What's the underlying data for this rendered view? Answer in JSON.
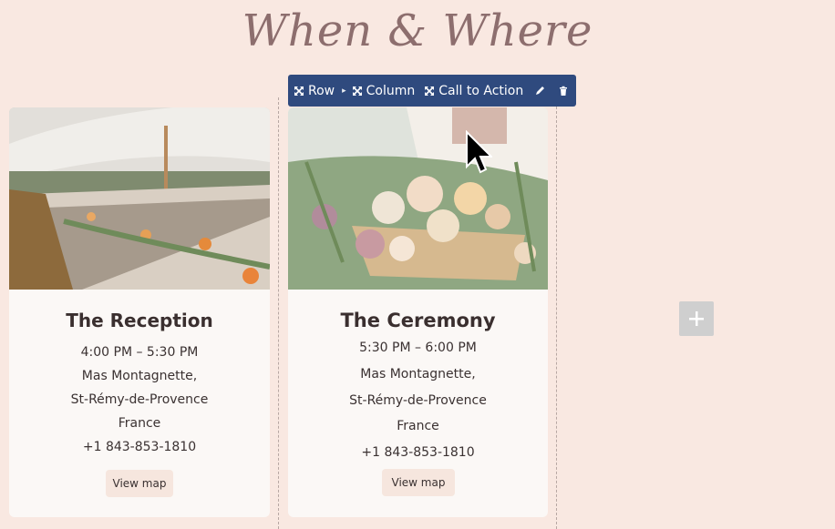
{
  "page": {
    "title": "When & Where"
  },
  "toolbar": {
    "row_label": "Row",
    "column_label": "Column",
    "cta_label": "Call to Action"
  },
  "cards": [
    {
      "title": "The Reception",
      "time": "4:00 PM – 5:30 PM",
      "venue": "Mas Montagnette,",
      "city": "St-Rémy-de-Provence",
      "country": "France",
      "phone": "+1 843-853-1810",
      "map_label": "View map"
    },
    {
      "title": "The Ceremony",
      "time": "5:30 PM – 6:00 PM",
      "venue": "Mas Montagnette,",
      "city": "St-Rémy-de-Provence",
      "country": "France",
      "phone": "+1 843-853-1810",
      "map_label": "View map"
    }
  ],
  "colors": {
    "toolbar_bg": "#2f4a7e",
    "page_bg": "#f9e8e1",
    "add_button": "#cfcfcf"
  },
  "icons": [
    "move-icon",
    "chevron-right-icon",
    "pencil-icon",
    "trash-icon",
    "plus-icon",
    "mouse-cursor-icon"
  ]
}
